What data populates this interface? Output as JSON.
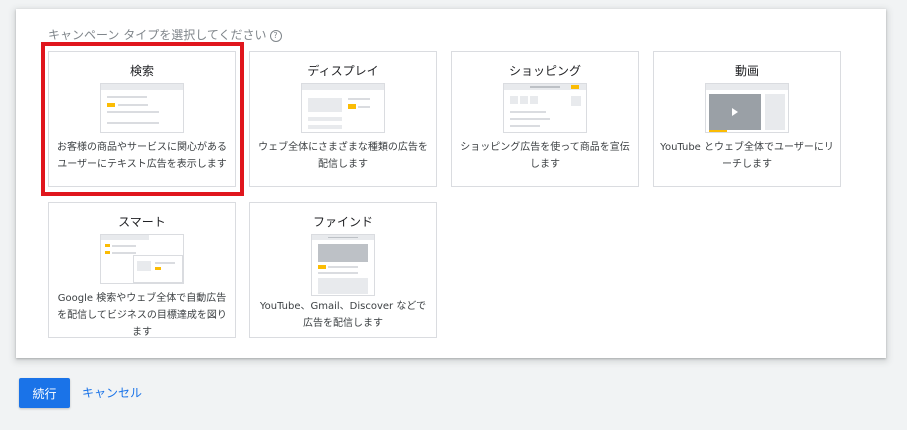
{
  "prompt": "キャンペーン タイプを選択してください",
  "help_icon": "question-circle-icon",
  "cards": [
    {
      "title": "検索",
      "desc": "お客様の商品やサービスに関心があるユーザーにテキスト広告を表示します"
    },
    {
      "title": "ディスプレイ",
      "desc": "ウェブ全体にさまざまな種類の広告を配信します"
    },
    {
      "title": "ショッピング",
      "desc": "ショッピング広告を使って商品を宣伝します"
    },
    {
      "title": "動画",
      "desc": "YouTube とウェブ全体でユーザーにリーチします"
    },
    {
      "title": "スマート",
      "desc": "Google 検索やウェブ全体で自動広告を配信してビジネスの目標達成を図ります"
    },
    {
      "title": "ファインド",
      "desc": "YouTube、Gmail、Discover などで広告を配信します"
    }
  ],
  "actions": {
    "continue_label": "続行",
    "cancel_label": "キャンセル"
  },
  "colors": {
    "accent": "#1a73e8",
    "highlight": "#e0161d",
    "ad_yellow": "#fbbc04"
  }
}
